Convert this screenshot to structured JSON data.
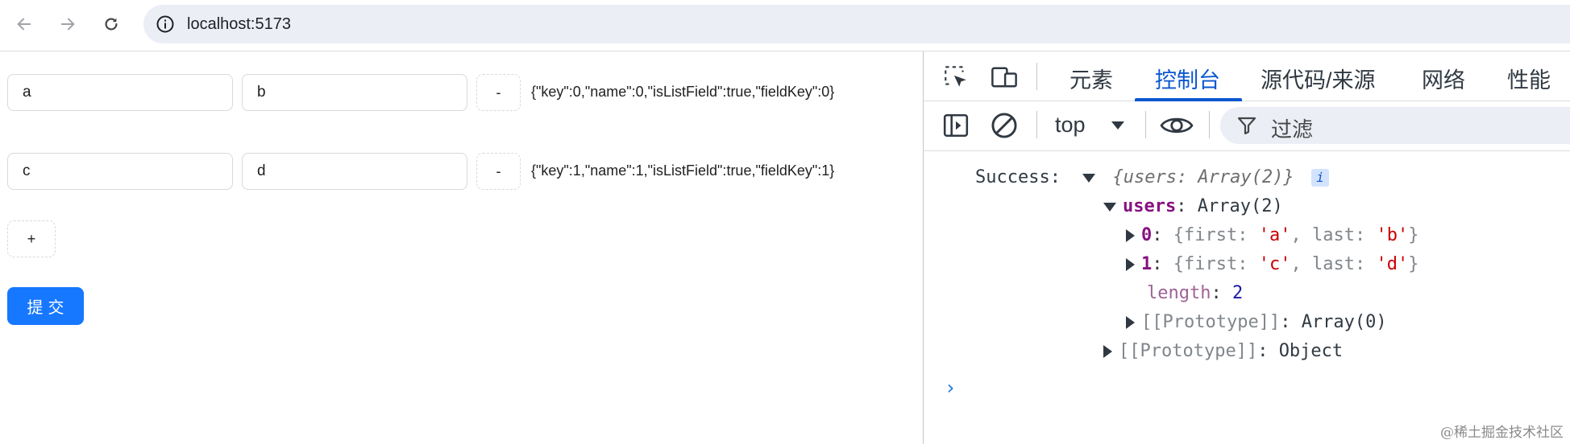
{
  "browser": {
    "url": "localhost:5173",
    "back_icon": "arrow-left-icon",
    "forward_icon": "arrow-right-icon",
    "reload_icon": "reload-icon",
    "info_icon": "info-circle-icon"
  },
  "form": {
    "rows": [
      {
        "first": "a",
        "last": "b",
        "remove_label": "-",
        "field_json": "{\"key\":0,\"name\":0,\"isListField\":true,\"fieldKey\":0}"
      },
      {
        "first": "c",
        "last": "d",
        "remove_label": "-",
        "field_json": "{\"key\":1,\"name\":1,\"isListField\":true,\"fieldKey\":1}"
      }
    ],
    "add_label": "+",
    "submit_label": "提交",
    "submit_color": "#1677ff"
  },
  "devtools": {
    "tabs": [
      "元素",
      "控制台",
      "源代码/来源",
      "网络",
      "性能"
    ],
    "active_tab": "控制台",
    "context": "top",
    "filter_placeholder": "过滤",
    "accent_color": "#0b57d0"
  },
  "console": {
    "label": "Success:",
    "summary": "{users: Array(2)}",
    "info_badge": "i",
    "users_key": "users",
    "users_type": "Array(2)",
    "item0_index": "0",
    "item0_first": "'a'",
    "item0_last": "'b'",
    "item1_index": "1",
    "item1_first": "'c'",
    "item1_last": "'d'",
    "first_key": "first",
    "last_key": "last",
    "length_key": "length",
    "length_value": "2",
    "array_proto": "[[Prototype]]",
    "array_proto_value": "Array(0)",
    "object_proto": "[[Prototype]]",
    "object_proto_value": "Object",
    "prompt": "›"
  },
  "watermark": "@稀土掘金技术社区"
}
